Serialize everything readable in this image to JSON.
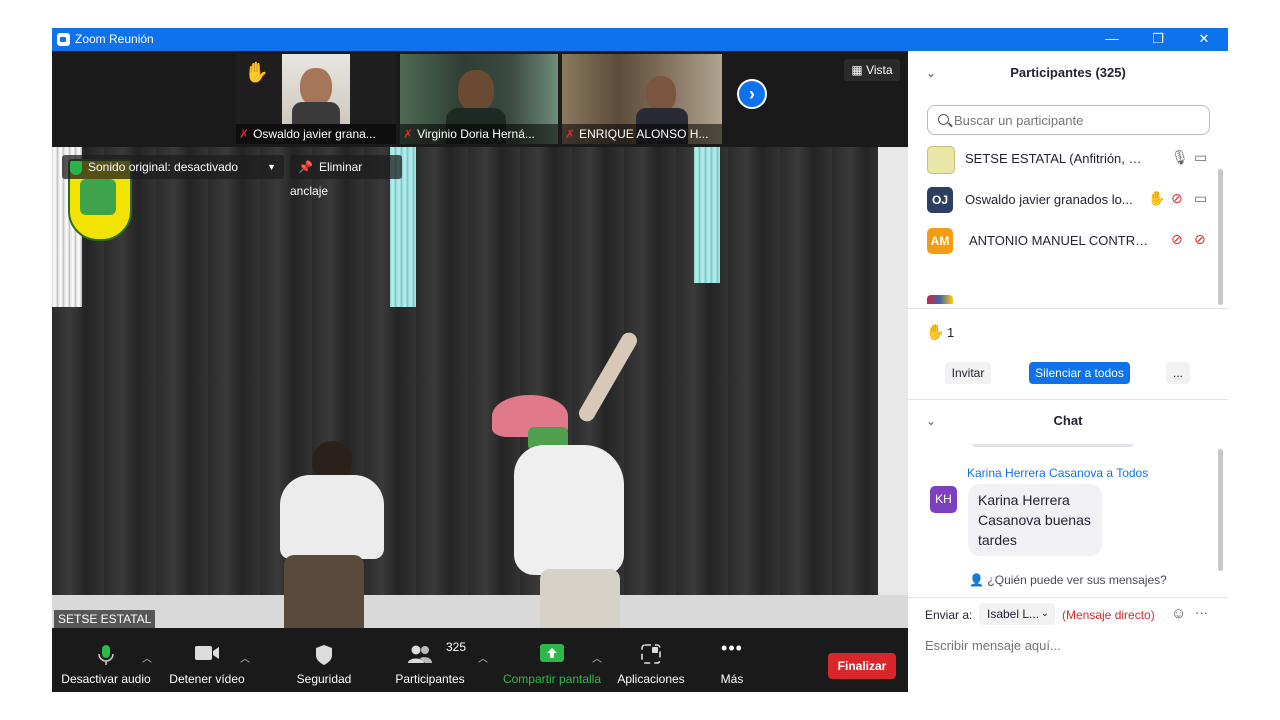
{
  "window": {
    "title": "Zoom Reunión",
    "controls": {
      "minimize": "—",
      "restore": "❐",
      "close": "✕"
    }
  },
  "gallery": {
    "tiles": [
      {
        "name": "Oswaldo javier grana...",
        "raised_hand": "✋"
      },
      {
        "name": "Virginio Doria Herná..."
      },
      {
        "name": "ENRIQUE ALONSO H..."
      }
    ],
    "view_label": "Vista"
  },
  "stage": {
    "original_sound": "Sonido original: desactivado",
    "unpin": "Eliminar anclaje",
    "speaker_name": "SETSE ESTATAL"
  },
  "toolbar": {
    "mute": "Desactivar audio",
    "video": "Detener vídeo",
    "security": "Seguridad",
    "participants": "Participantes",
    "participants_count": "325",
    "share": "Compartir pantalla",
    "apps": "Aplicaciones",
    "more": "Más",
    "end": "Finalizar"
  },
  "participants_panel": {
    "title": "Participantes (325)",
    "search_placeholder": "Buscar un participante",
    "rows": [
      {
        "initials": "",
        "name": "SETSE ESTATAL (Anfitrión, yo)",
        "color": "#e9e6a8"
      },
      {
        "initials": "OJ",
        "name": "Oswaldo javier granados lo...",
        "color": "#2c3e62"
      },
      {
        "initials": "AM",
        "name": "ANTONIO MANUEL CONTRER...",
        "color": "#f39c12"
      }
    ],
    "raised_count": "1",
    "invite": "Invitar",
    "mute_all": "Silenciar a todos",
    "more": "..."
  },
  "chat": {
    "title": "Chat",
    "message": {
      "from": "Karina Herrera Casanova a Todos",
      "initials": "KH",
      "text": "Karina Herrera Casanova buenas tardes"
    },
    "who_can_see": "¿Quién puede ver sus mensajes?",
    "send_to_label": "Enviar a:",
    "recipient": "Isabel L...",
    "direct": "(Mensaje directo)",
    "input_placeholder": "Escribir mensaje aquí..."
  }
}
